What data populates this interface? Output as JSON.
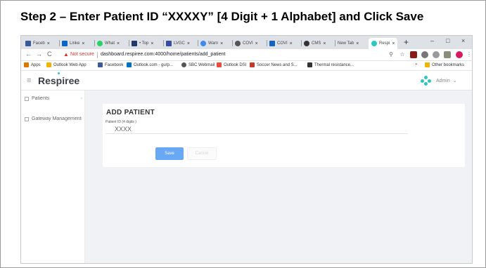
{
  "slide": {
    "title": "Step 2 – Enter Patient ID “XXXXY” [4 Digit + 1 Alphabet] and Click Save"
  },
  "browser": {
    "tabs": [
      {
        "label": "Faceb",
        "color": "#3b5998"
      },
      {
        "label": "Linke",
        "color": "#0a66c2"
      },
      {
        "label": "What",
        "color": "#25d366"
      },
      {
        "label": "• Top",
        "color": "#1f3a6b"
      },
      {
        "label": "LVGC",
        "color": "#3b4aa0"
      },
      {
        "label": "Warn",
        "color": "#4285f4"
      },
      {
        "label": "COVI",
        "color": "#555555"
      },
      {
        "label": "COVI",
        "color": "#1565c0"
      },
      {
        "label": "CMS",
        "color": "#333333"
      },
      {
        "label": "New Tab",
        "color": "#ffffff"
      },
      {
        "label": "Respi",
        "color": "#2ec7c0"
      }
    ],
    "tab_close": "×",
    "new_tab": "+",
    "window_controls": [
      "–",
      "□",
      "×"
    ],
    "nav": {
      "back": "←",
      "forward": "→",
      "reload": "C"
    },
    "warning_icon": "▲",
    "not_secure": "Not secure",
    "url": "dashboard.respiree.com:4000/home/patients/add_patient",
    "bookmarks": [
      {
        "label": "Apps",
        "color": "#e37400"
      },
      {
        "label": "Outlook Web App",
        "color": "#f2b400"
      },
      {
        "label": "Facebook",
        "color": "#3b5998"
      },
      {
        "label": "Outlook.com - gurp...",
        "color": "#0072c6"
      },
      {
        "label": "SBC Webmail",
        "color": "#555555"
      },
      {
        "label": "Outlook DSI",
        "color": "#e74c3c"
      },
      {
        "label": "Soccer News and S...",
        "color": "#c0392b"
      },
      {
        "label": "Thermal resistance...",
        "color": "#333333"
      }
    ],
    "bookmarks_more": "»",
    "other_bookmarks": "Other bookmarks"
  },
  "app": {
    "brand": "Respiree",
    "hamburger": "≡",
    "user": "Admin",
    "user_chevron": "⌄",
    "sidebar": {
      "items": [
        {
          "label": "Patients",
          "chevron": "›"
        },
        {
          "label": "Gateway Management",
          "chevron": "›"
        }
      ]
    },
    "form": {
      "title": "ADD PATIENT",
      "patient_id_label": "Patient ID (4 digits )",
      "patient_id_value": "XXXX",
      "save_label": "Save",
      "cancel_label": "Cancel"
    },
    "accent_color": "#2ec7c0",
    "save_color": "#69a8f5"
  }
}
